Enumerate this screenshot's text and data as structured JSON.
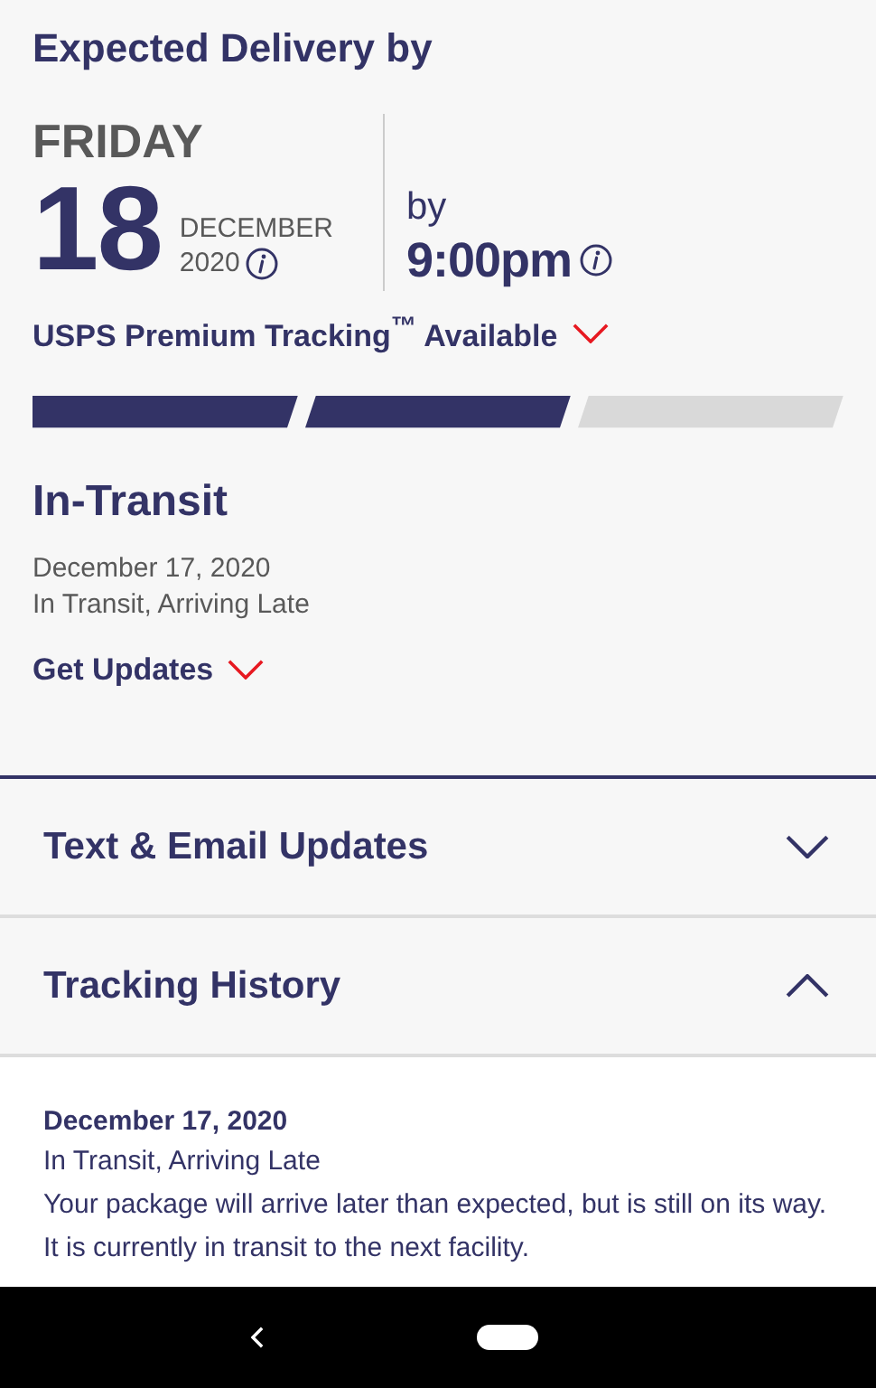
{
  "heading": "Expected Delivery by",
  "delivery": {
    "weekday": "FRIDAY",
    "day": "18",
    "month": "DECEMBER",
    "year": "2020",
    "by_label": "by",
    "time": "9:00pm"
  },
  "premium_tracking": {
    "label": "USPS Premium Tracking$^{™}$ Available",
    "expanded": false
  },
  "progress": [
    {
      "filled": true
    },
    {
      "filled": true
    },
    {
      "filled": false
    }
  ],
  "status": {
    "title": "In-Transit",
    "date": "December 17, 2020",
    "detail": "In Transit, Arriving Late"
  },
  "get_updates": {
    "label": "Get Updates",
    "expanded": false
  },
  "sections": [
    {
      "title": "Text & Email Updates",
      "expanded": false
    },
    {
      "title": "Tracking History",
      "expanded": true
    }
  ],
  "history": [
    {
      "date": "December 17, 2020",
      "status": "In Transit, Arriving Late",
      "description": "Your package will arrive later than expected, but is still on its way. It is currently in transit to the next facility."
    }
  ]
}
